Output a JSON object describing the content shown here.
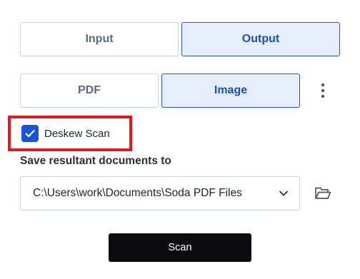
{
  "mode_tabs": {
    "input_label": "Input",
    "output_label": "Output",
    "selected": "Output"
  },
  "format_tabs": {
    "pdf_label": "PDF",
    "image_label": "Image",
    "selected": "Image"
  },
  "more_menu": {
    "icon": "kebab-vertical-icon"
  },
  "deskew": {
    "label": "Deskew Scan",
    "checked": true,
    "highlight_color": "#e01b1b"
  },
  "save_location": {
    "label": "Save resultant documents to",
    "selected_path": "C:\\Users\\work\\Documents\\Soda PDF Files",
    "dropdown_icon": "chevron-down-icon",
    "browse_icon": "folder-open-icon"
  },
  "scan_button": {
    "label": "Scan"
  },
  "colors": {
    "accent": "#1a54d6",
    "selected_tab_bg": "#e6eefb",
    "selected_tab_border": "#2c55b0",
    "primary_button_bg": "#0b0b0d"
  }
}
